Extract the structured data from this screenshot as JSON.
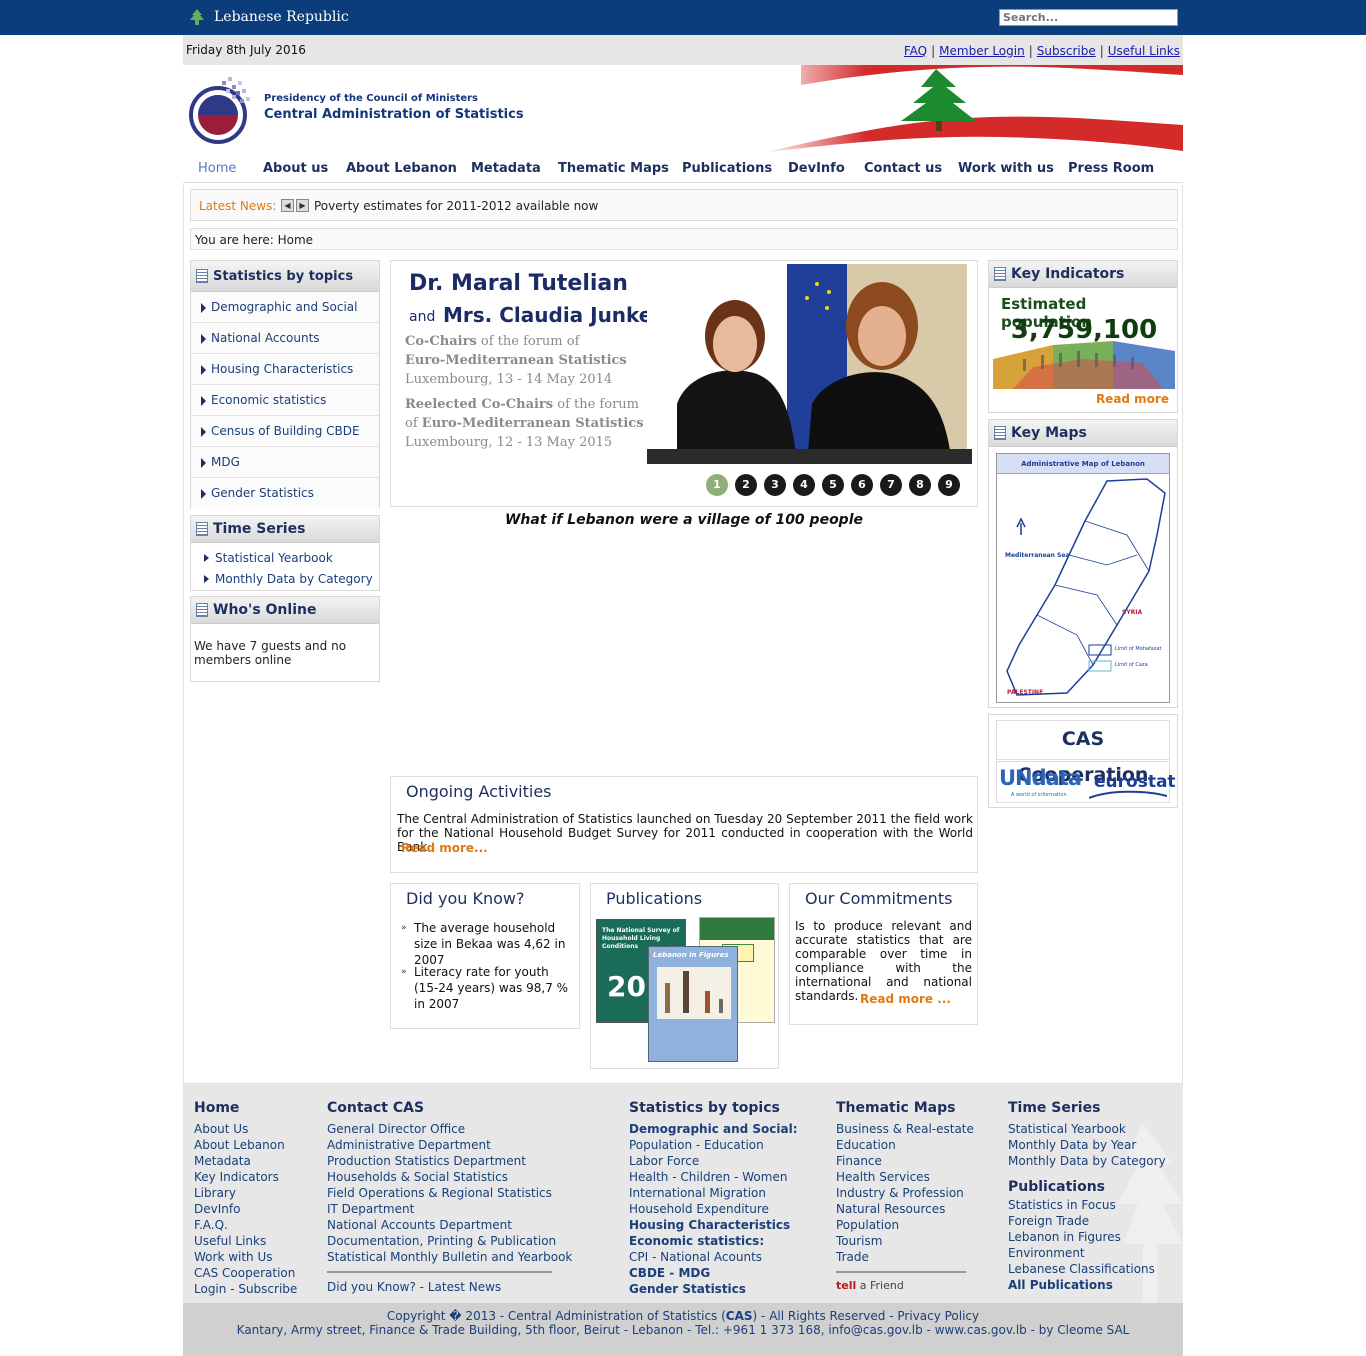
{
  "topbar": {
    "title": "Lebanese Republic",
    "search_placeholder": "Search..."
  },
  "datebar": {
    "date": "Friday 8th July 2016",
    "links": [
      "FAQ",
      "Member Login",
      "Subscribe",
      "Useful Links"
    ],
    "sep": "|"
  },
  "header": {
    "line1": "Presidency of the Council of Ministers",
    "line2": "Central Administration of Statistics"
  },
  "nav": [
    "Home",
    "About us",
    "About Lebanon",
    "Metadata",
    "Thematic Maps",
    "Publications",
    "DevInfo",
    "Contact us",
    "Work with us",
    "Press Room"
  ],
  "news": {
    "label": "Latest News:",
    "text": "Poverty estimates for 2011-2012 available now"
  },
  "breadcrumb": "You are here: Home",
  "sidebar": {
    "topics_title": "Statistics by topics",
    "topics": [
      "Demographic and Social",
      "National Accounts",
      "Housing Characteristics",
      "Economic statistics",
      "Census of Building CBDE",
      "MDG",
      "Gender Statistics"
    ],
    "timeseries_title": "Time Series",
    "timeseries": [
      "Statistical Yearbook",
      "Monthly Data by Category"
    ],
    "online_title": "Who's Online",
    "online_text": "We have 7 guests and no members online"
  },
  "slider": {
    "name1": "Dr. Maral Tutelian",
    "and": "and",
    "name2": "Mrs. Claudia Junker",
    "l1a": "Co-Chairs",
    "l1b": " of the forum of",
    "l2": "Euro-Mediterranean Statistics",
    "l3": "Luxembourg, 13 - 14 May 2014",
    "l4a": "Reelected Co-Chairs",
    "l4b": " of the forum",
    "l5a": "of ",
    "l5b": "Euro-Mediterranean Statistics",
    "l6": "Luxembourg, 12 - 13 May 2015",
    "pages": [
      "1",
      "2",
      "3",
      "4",
      "5",
      "6",
      "7",
      "8",
      "9"
    ],
    "current_page": "1"
  },
  "caption": "What if Lebanon were a village of 100 people",
  "ongoing": {
    "title": "Ongoing Activities",
    "text": "The Central Administration of Statistics launched on Tuesday 20 September 2011 the field work for the National Household Budget Survey for 2011 conducted in cooperation with the World Bank.",
    "more": "Read more..."
  },
  "didyouknow": {
    "title": "Did you Know?",
    "items": [
      "The average household size in Bekaa was 4,62 in 2007",
      "Literacy rate for youth (15-24 years) was 98,7 % in 2007"
    ]
  },
  "publications": {
    "title": "Publications",
    "cover1_title": "The National Survey of Household Living Conditions",
    "cover1_year": "20",
    "cover3_title": "Lebanon in Figures"
  },
  "commitments": {
    "title": "Our Commitments",
    "text": "Is to produce relevant and accurate statistics that are comparable over time in compliance with the international and national standards.",
    "more": "Read more ..."
  },
  "right": {
    "key_indicators_title": "Key Indicators",
    "est_label": "Estimated population",
    "est_value": "3,759,100",
    "read_more": "Read more",
    "key_maps_title": "Key Maps",
    "map_title": "Administrative Map of Lebanon",
    "map_sea": "Mediterranean Sea",
    "map_syria": "SYRIA",
    "map_palestine": "PALESTINE",
    "map_legend1": "Limit of Mohafazat",
    "map_legend2": "Limit of Caza",
    "coop_title": "CAS Cooperation",
    "undata": "UNdata",
    "undata_sub": "A world of information",
    "eurostat": "eurostat"
  },
  "footer": {
    "col1_head": "Home",
    "col1": [
      "About Us",
      "About Lebanon",
      "Metadata",
      "Key Indicators",
      "Library",
      "DevInfo",
      "F.A.Q.",
      "Useful Links",
      "Work with Us",
      "CAS Cooperation",
      "Login - Subscribe"
    ],
    "col2_head": "Contact CAS",
    "col2": [
      "General Director Office",
      "Administrative Department",
      "Production Statistics Department",
      "Households & Social Statistics",
      "Field Operations & Regional Statistics",
      "IT Department",
      "National Accounts Department",
      "Documentation, Printing & Publication",
      "Statistical Monthly Bulletin and Yearbook"
    ],
    "col2_extra": "Did you Know? - Latest News",
    "col3_head": "Statistics by topics",
    "col3": [
      {
        "t": "Demographic and Social:",
        "b": true
      },
      {
        "t": "Population - Education",
        "b": false
      },
      {
        "t": "Labor Force",
        "b": false
      },
      {
        "t": "Health - Children - Women",
        "b": false
      },
      {
        "t": "International Migration",
        "b": false
      },
      {
        "t": "Household Expenditure",
        "b": false
      },
      {
        "t": "Housing Characteristics",
        "b": true
      },
      {
        "t": "Economic statistics:",
        "b": true
      },
      {
        "t": "CPI - National Acounts",
        "b": false
      },
      {
        "t": "CBDE - MDG",
        "b": true
      },
      {
        "t": "Gender Statistics",
        "b": true
      }
    ],
    "col4_head": "Thematic Maps",
    "col4": [
      "Business & Real-estate",
      "Education",
      "Finance",
      "Health Services",
      "Industry & Profession",
      "Natural Resources",
      "Population",
      "Tourism",
      "Trade"
    ],
    "tell": "tell",
    "tell_suffix": "a Friend",
    "col5_head": "Time Series",
    "col5": [
      "Statistical Yearbook",
      "Monthly Data by Year",
      "Monthly Data by Category"
    ],
    "col5b_head": "Publications",
    "col5b": [
      "Statistics in Focus",
      "Foreign Trade",
      "Lebanon in Figures",
      "Environment",
      "Lebanese Classifications"
    ],
    "col5b_last": "All Publications"
  },
  "copyright": {
    "l1_pre": "Copyright � 2013 - Central Administration of Statistics (",
    "l1_cas": "CAS",
    "l1_post": ") - All Rights Reserved - Privacy Policy",
    "l2": "Kantary, Army street, Finance & Trade Building, 5th floor, Beirut - Lebanon - Tel.: +961 1 373 168, info@cas.gov.lb - www.cas.gov.lb - by Cleome SAL"
  },
  "colors": {
    "topbar": "#0b3d7d",
    "nav_text": "#1d2f5f",
    "orange": "#e07a12",
    "link": "#1a3f7a"
  }
}
